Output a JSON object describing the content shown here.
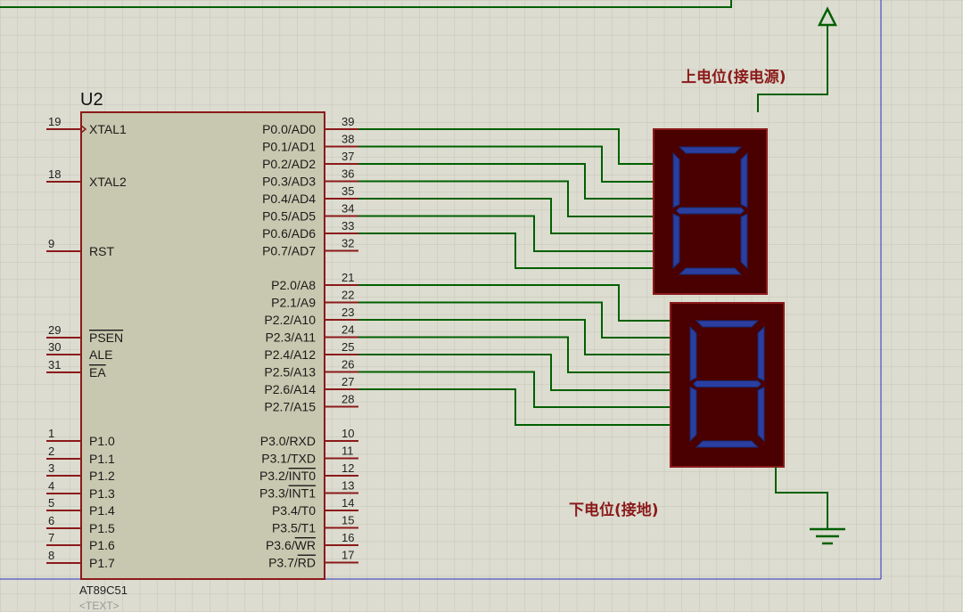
{
  "chip": {
    "ref": "U2",
    "part": "AT89C51",
    "text_placeholder": "<TEXT>",
    "left_pins": [
      {
        "num": "19",
        "name": "XTAL1"
      },
      {
        "num": "18",
        "name": "XTAL2"
      },
      {
        "num": "9",
        "name": "RST"
      },
      {
        "num": "29",
        "name": "PSEN"
      },
      {
        "num": "30",
        "name": "ALE"
      },
      {
        "num": "31",
        "name": "EA"
      },
      {
        "num": "1",
        "name": "P1.0"
      },
      {
        "num": "2",
        "name": "P1.1"
      },
      {
        "num": "3",
        "name": "P1.2"
      },
      {
        "num": "4",
        "name": "P1.3"
      },
      {
        "num": "5",
        "name": "P1.4"
      },
      {
        "num": "6",
        "name": "P1.5"
      },
      {
        "num": "7",
        "name": "P1.6"
      },
      {
        "num": "8",
        "name": "P1.7"
      }
    ],
    "right_pins": [
      {
        "num": "39",
        "name": "P0.0/AD0"
      },
      {
        "num": "38",
        "name": "P0.1/AD1"
      },
      {
        "num": "37",
        "name": "P0.2/AD2"
      },
      {
        "num": "36",
        "name": "P0.3/AD3"
      },
      {
        "num": "35",
        "name": "P0.4/AD4"
      },
      {
        "num": "34",
        "name": "P0.5/AD5"
      },
      {
        "num": "33",
        "name": "P0.6/AD6"
      },
      {
        "num": "32",
        "name": "P0.7/AD7"
      },
      {
        "num": "21",
        "name": "P2.0/A8"
      },
      {
        "num": "22",
        "name": "P2.1/A9"
      },
      {
        "num": "23",
        "name": "P2.2/A10"
      },
      {
        "num": "24",
        "name": "P2.3/A11"
      },
      {
        "num": "25",
        "name": "P2.4/A12"
      },
      {
        "num": "26",
        "name": "P2.5/A13"
      },
      {
        "num": "27",
        "name": "P2.6/A14"
      },
      {
        "num": "28",
        "name": "P2.7/A15"
      },
      {
        "num": "10",
        "name": "P3.0/RXD"
      },
      {
        "num": "11",
        "name": "P3.1/TXD"
      },
      {
        "num": "12",
        "name": "P3.2/INT0"
      },
      {
        "num": "13",
        "name": "P3.3/INT1"
      },
      {
        "num": "14",
        "name": "P3.4/T0"
      },
      {
        "num": "15",
        "name": "P3.5/T1"
      },
      {
        "num": "16",
        "name": "P3.6/WR"
      },
      {
        "num": "17",
        "name": "P3.7/RD"
      }
    ]
  },
  "labels": {
    "upper": "上电位(接电源)",
    "lower": "下电位(接地)"
  },
  "colors": {
    "wire": "#006000",
    "pin": "#8b1a1a",
    "segment": "#2a3fa0",
    "display_bg": "#4a0000"
  }
}
